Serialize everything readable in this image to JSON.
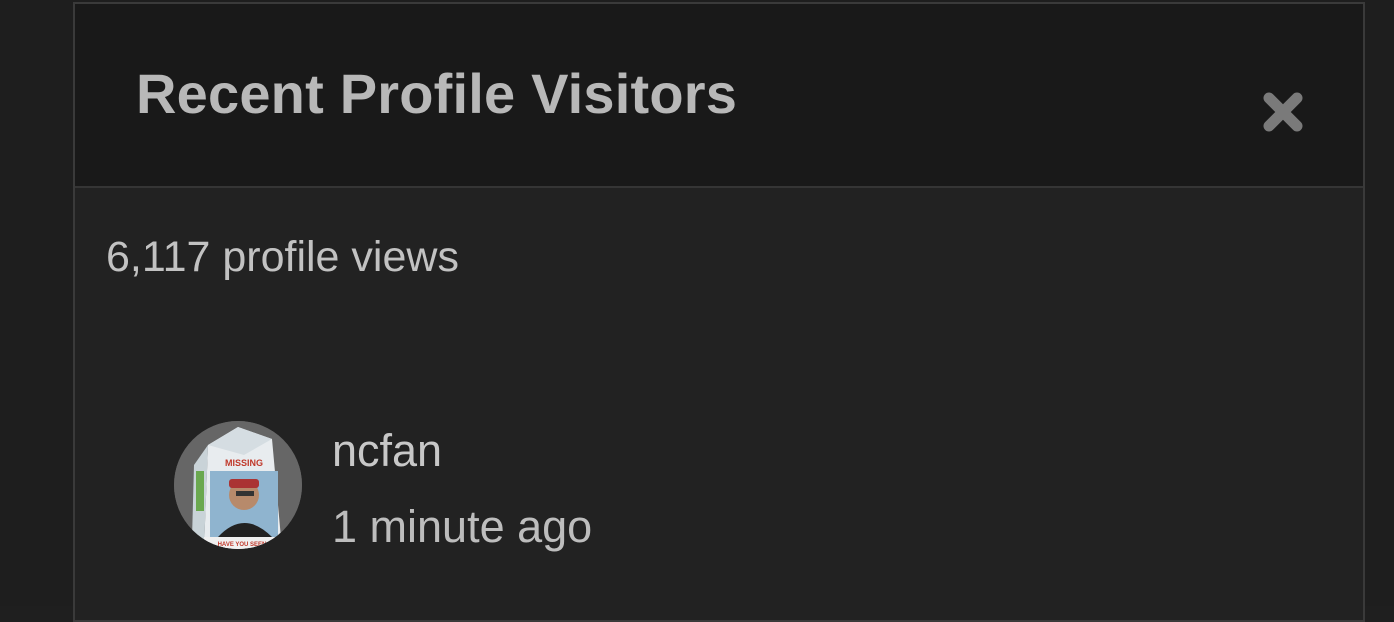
{
  "modal": {
    "title": "Recent Profile Visitors",
    "close_icon": "close-icon"
  },
  "stats": {
    "profile_views": "6,117 profile views"
  },
  "visitors": [
    {
      "name": "ncfan",
      "time": "1 minute ago",
      "avatar_text_top": "MISSING",
      "avatar_text_bottom": "HAVE YOU SEEN"
    }
  ],
  "colors": {
    "background": "#1e1e1e",
    "panel": "#222222",
    "header": "#191919",
    "text": "#c2c2c2",
    "title": "#b8b8b8"
  }
}
